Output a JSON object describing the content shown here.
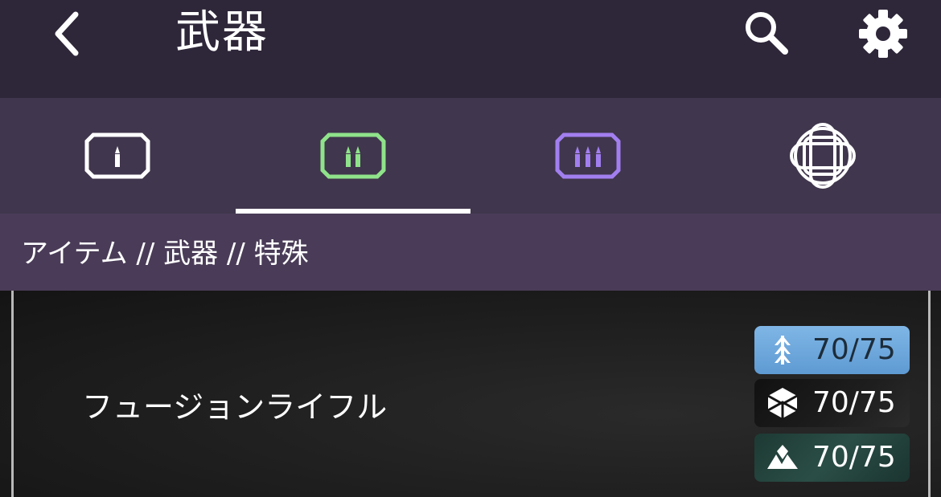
{
  "header": {
    "title": "武器",
    "back_icon": "chevron-left-icon",
    "search_icon": "search-icon",
    "settings_icon": "gear-icon"
  },
  "tabs": [
    {
      "name": "primary",
      "icon": "primary-ammo-icon",
      "color": "#ffffff",
      "selected": false
    },
    {
      "name": "special",
      "icon": "special-ammo-icon",
      "color": "#8fe38a",
      "selected": true
    },
    {
      "name": "heavy",
      "icon": "heavy-ammo-icon",
      "color": "#a27ff0",
      "selected": false
    },
    {
      "name": "other",
      "icon": "knot-emblem-icon",
      "color": "#ffffff",
      "selected": false
    }
  ],
  "breadcrumb": "アイテム // 武器 // 特殊",
  "item": {
    "name": "フュージョンライフル",
    "badges": [
      {
        "class": "hunter",
        "icon": "hunter-icon",
        "value": "70/75",
        "color": "#6aa6dc"
      },
      {
        "class": "titan",
        "icon": "titan-icon",
        "value": "70/75",
        "color": "#151515"
      },
      {
        "class": "warlock",
        "icon": "warlock-icon",
        "value": "70/75",
        "color": "#26463f"
      }
    ]
  }
}
